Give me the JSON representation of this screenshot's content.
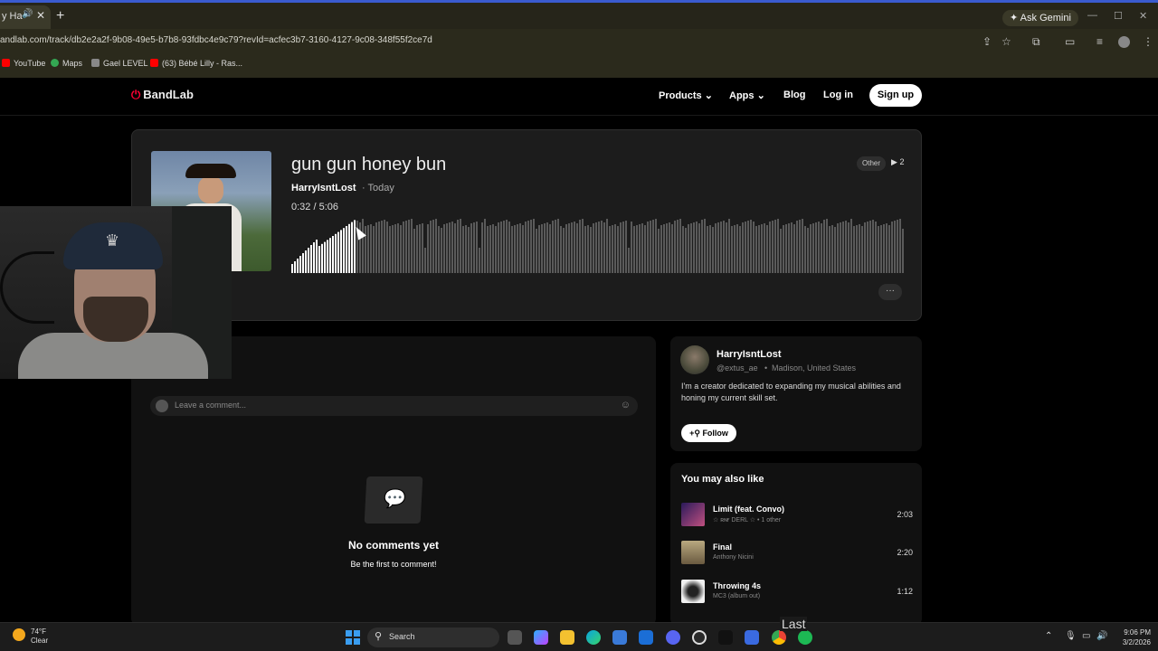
{
  "browser": {
    "tab_label": "y Ha",
    "ask_gemini": "Ask Gemini",
    "url": "andlab.com/track/db2e2a2f-9b08-49e5-b7b8-93fdbc4e9c79?revId=acfec3b7-3160-4127-9c08-348f55f2ce7d",
    "bookmarks": [
      {
        "label": "YouTube",
        "color": "#ff0000"
      },
      {
        "label": "Maps",
        "color": "#34a853"
      },
      {
        "label": "Gael LEVEL",
        "color": "#888888"
      },
      {
        "label": "(63) Bébé Lilly - Ras...",
        "color": "#ff0000"
      }
    ]
  },
  "site_nav": {
    "logo": "BandLab",
    "products": "Products",
    "apps": "Apps",
    "blog": "Blog",
    "login": "Log in",
    "signup": "Sign up"
  },
  "track": {
    "title": "gun gun honey bun",
    "artist": "HarryIsntLost",
    "when": "· Today",
    "time": "0:32 /  5:06",
    "genre": "Other",
    "plays": "2",
    "progress": 0.105,
    "more": "···"
  },
  "comments": {
    "label": "s",
    "placeholder": "Leave a comment...",
    "empty_title": "No comments yet",
    "empty_sub": "Be the first to comment!"
  },
  "profile": {
    "name": "HarryIsntLost",
    "handle": "@extus_ae",
    "separator": "•",
    "location": "Madison, United States",
    "bio": "I'm a creator dedicated to expanding my musical abilities and honing my current skill set.",
    "follow": "Follow"
  },
  "also_like": {
    "title": "You may also like",
    "items": [
      {
        "title": "Limit (feat. Convo)",
        "artist": "☆ ʀɴғ DERL ☆ • 1 other",
        "duration": "2:03",
        "color": "#6a4a8a"
      },
      {
        "title": "Final",
        "artist": "Anthony Nicini",
        "duration": "2:20",
        "color": "#a89a70"
      },
      {
        "title": "Throwing 4s",
        "artist": "MC3 (album out)",
        "duration": "1:12",
        "color": "#e0e0e0"
      }
    ]
  },
  "taskbar": {
    "temp": "74°F",
    "condition": "Clear",
    "search": "Search",
    "tooltip": "Last",
    "time": "9:06 PM",
    "date": "3/2/2026"
  }
}
